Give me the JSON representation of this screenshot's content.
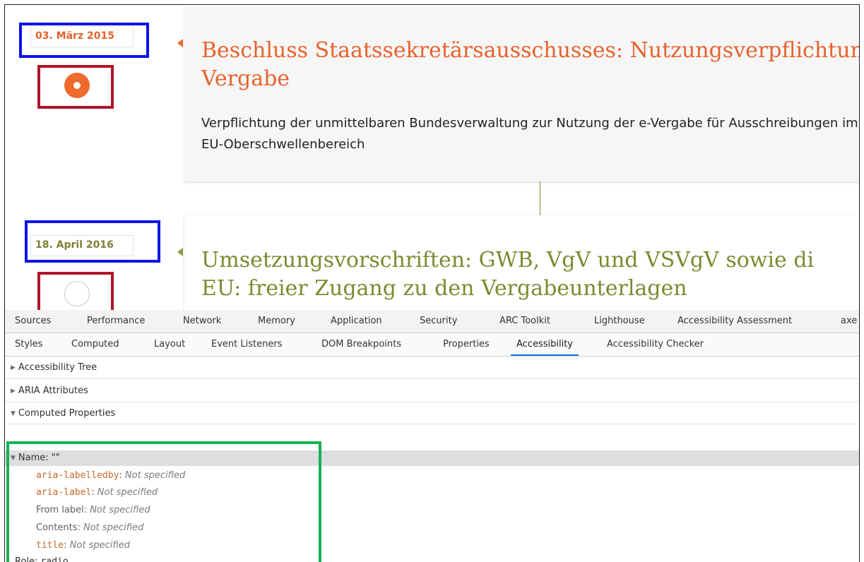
{
  "timeline": {
    "entries": [
      {
        "date": "03. März 2015",
        "title_line1": "Beschluss Staatssekretärsausschusses: Nutzungsverpflichtung",
        "title_line2": "Vergabe",
        "description": "Verpflichtung der unmittelbaren Bundesverwaltung zur Nutzung der e-Vergabe für Ausschreibungen im EU-Oberschwellenbereich",
        "state": "active"
      },
      {
        "date": "18. April 2016",
        "title_line1": "Umsetzungsvorschriften: GWB, VgV und VSVgV sowie di",
        "title_line2": "EU: freier Zugang zu den Vergabeunterlagen",
        "state": "inactive"
      }
    ],
    "colors": {
      "active": "#ef6a2b",
      "inactive": "#7d8a2f"
    }
  },
  "devtools": {
    "main_tabs": [
      "Sources",
      "Performance",
      "Network",
      "Memory",
      "Application",
      "Security",
      "ARC Toolkit",
      "Lighthouse",
      "Accessibility Assessment",
      "axe"
    ],
    "sub_tabs": [
      "Styles",
      "Computed",
      "Layout",
      "Event Listeners",
      "DOM Breakpoints",
      "Properties",
      "Accessibility",
      "Accessibility Checker"
    ],
    "active_sub_tab": "Accessibility",
    "sections": {
      "tree": "Accessibility Tree",
      "aria": "ARIA Attributes",
      "computed": "Computed Properties"
    },
    "name_row": "Name: \"\"",
    "name_sources": [
      {
        "label": "aria-labelledby",
        "code": true,
        "value": "Not specified"
      },
      {
        "label": "aria-label",
        "code": true,
        "value": "Not specified"
      },
      {
        "label": "From label",
        "code": false,
        "value": "Not specified"
      },
      {
        "label": "Contents",
        "code": false,
        "value": "Not specified"
      },
      {
        "label": "title",
        "code": true,
        "value": "Not specified"
      }
    ],
    "role_label": "Role:",
    "role_value": "radio"
  },
  "annotation_colors": {
    "date_highlight": "#0b14e8",
    "button_highlight": "#b0142a",
    "properties_highlight": "#17b254"
  }
}
